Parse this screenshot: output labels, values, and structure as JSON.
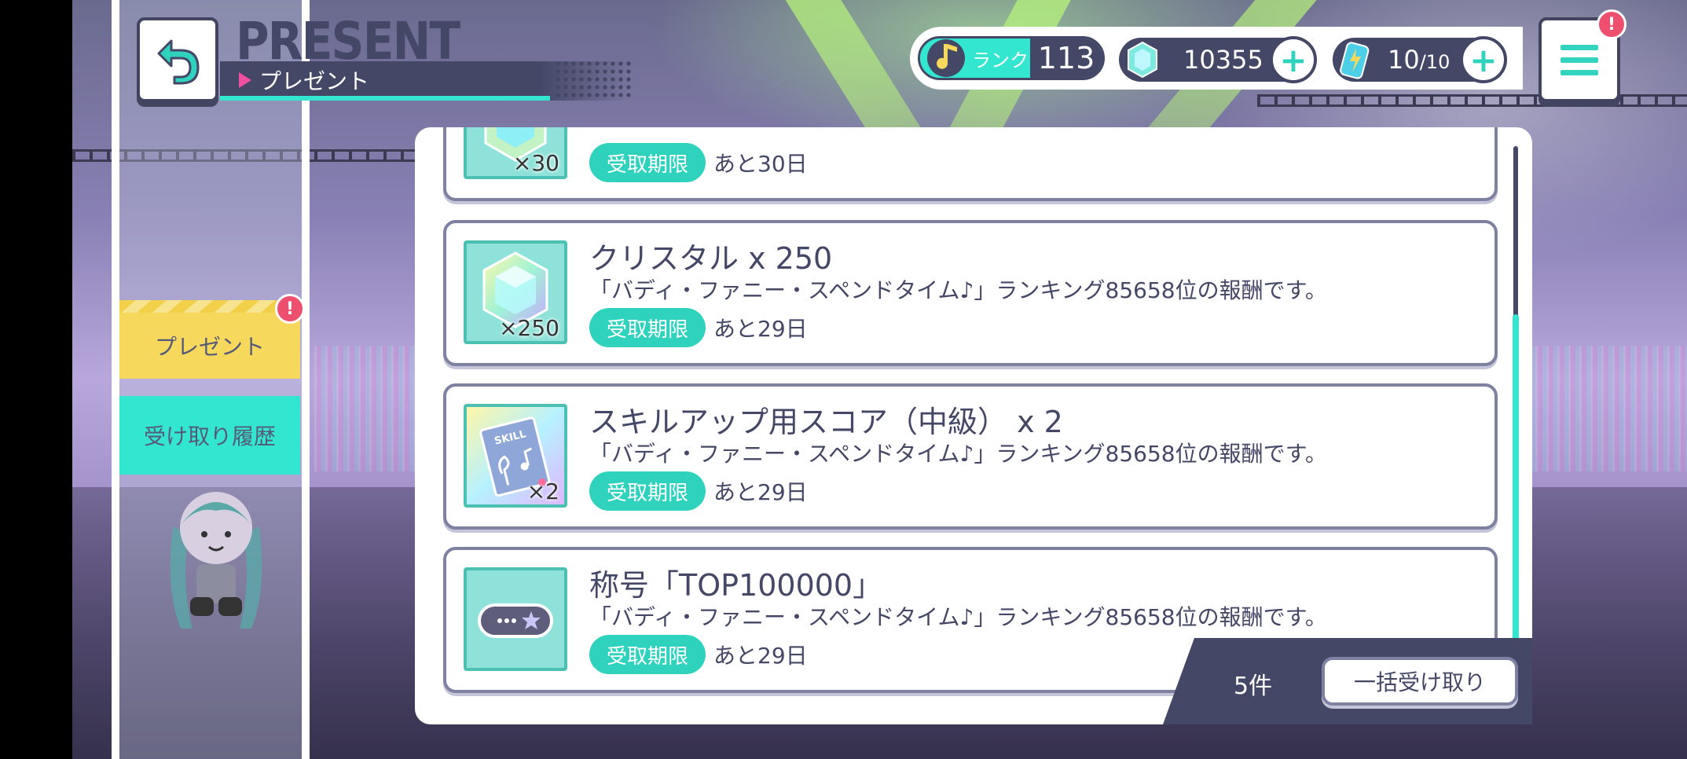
{
  "header": {
    "title_en": "PRESENT",
    "title_jp": "プレゼント"
  },
  "status": {
    "rank_label": "ランク",
    "rank_value": "113",
    "crystals": "10355",
    "energy_current": "10",
    "energy_max": "/10"
  },
  "sidebar": {
    "tabs": [
      {
        "label": "プレゼント",
        "active": true,
        "has_alert": true
      },
      {
        "label": "受け取り履歴",
        "active": false,
        "has_alert": false
      }
    ]
  },
  "alert_mark": "!",
  "deadline_label": "受取期限",
  "presents": [
    {
      "qty": "×30",
      "deadline": "あと30日",
      "icon": "crystal-icon"
    },
    {
      "name": "クリスタル x 250",
      "description": "「バディ・ファニー・スペンドタイム♪」ランキング85658位の報酬です。",
      "qty": "×250",
      "deadline": "あと29日",
      "icon": "crystal-icon"
    },
    {
      "name": "スキルアップ用スコア（中級） x 2",
      "description": "「バディ・ファニー・スペンドタイム♪」ランキング85658位の報酬です。",
      "qty": "×2",
      "skill_card_text": "SKILL",
      "deadline": "あと29日",
      "icon": "skill-score-icon"
    },
    {
      "name": "称号「TOP100000」",
      "description": "「バディ・ファニー・スペンドタイム♪」ランキング85658位の報酬です。",
      "deadline": "あと29日",
      "icon": "title-badge-icon"
    }
  ],
  "footer": {
    "count": "5件",
    "bulk_receive_label": "一括受け取り"
  },
  "colors": {
    "accent": "#33e6cf",
    "dark": "#444766",
    "alert": "#ee4f6f",
    "tab_active": "#f6d95c"
  }
}
